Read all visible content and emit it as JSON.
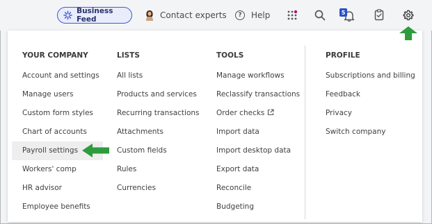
{
  "topbar": {
    "feed_label": "Business Feed",
    "contact_label": "Contact experts",
    "help_label": "Help",
    "help_glyph": "?",
    "notification_count": "5",
    "icons": [
      "sparkle-icon",
      "avatar",
      "help-icon",
      "apps-grid-icon",
      "search-icon",
      "bell-icon",
      "clipboard-icon",
      "gear-icon"
    ]
  },
  "menu": {
    "columns": [
      {
        "heading": "YOUR COMPANY",
        "items": [
          "Account and settings",
          "Manage users",
          "Custom form styles",
          "Chart of accounts",
          "Payroll settings",
          "Workers' comp",
          "HR advisor",
          "Employee benefits"
        ]
      },
      {
        "heading": "LISTS",
        "items": [
          "All lists",
          "Products and services",
          "Recurring transactions",
          "Attachments",
          "Custom fields",
          "Rules",
          "Currencies"
        ]
      },
      {
        "heading": "TOOLS",
        "items": [
          "Manage workflows",
          "Reclassify transactions",
          "Order checks",
          "Import data",
          "Import desktop data",
          "Export data",
          "Reconcile",
          "Budgeting"
        ]
      },
      {
        "heading": "PROFILE",
        "items": [
          "Subscriptions and billing",
          "Feedback",
          "Privacy",
          "Switch company"
        ]
      }
    ],
    "highlighted_item": "Payroll settings"
  },
  "colors": {
    "feed_border": "#3c5ad7",
    "badge": "#2b4fc7",
    "arrow": "#2e9b3e",
    "highlight": "#eeeeef"
  }
}
